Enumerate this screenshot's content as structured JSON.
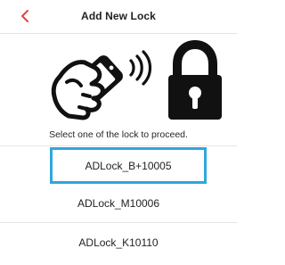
{
  "header": {
    "title": "Add New Lock",
    "back_icon": "chevron-left-icon",
    "accent_color": "#e2453c"
  },
  "hero": {
    "left_icon": "phone-in-hand-wireless-icon",
    "right_icon": "padlock-icon"
  },
  "instruction": "Select one of the lock to proceed.",
  "locks": [
    {
      "name": "ADLock_B+10005",
      "selected": true
    },
    {
      "name": "ADLock_M10006",
      "selected": false
    },
    {
      "name": "ADLock_K10110",
      "selected": false
    }
  ],
  "colors": {
    "selection_border": "#2ea7de",
    "divider": "#e6e6e6"
  }
}
